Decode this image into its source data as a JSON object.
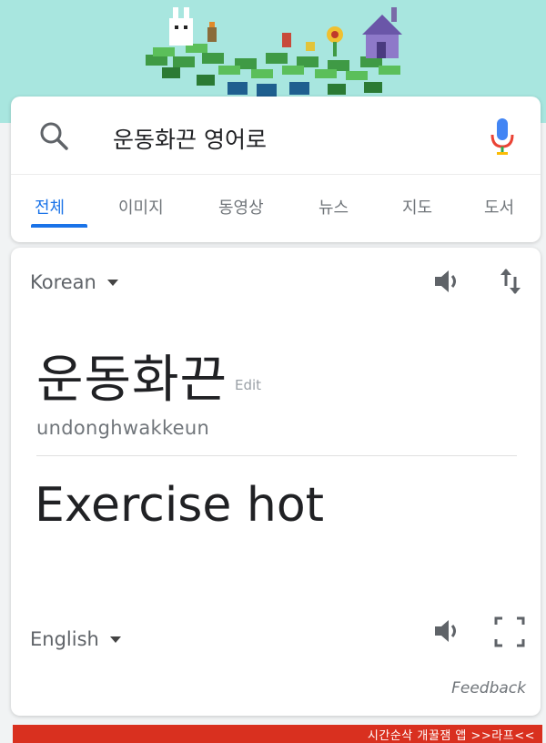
{
  "search": {
    "query": "운동화끈 영어로",
    "tabs": [
      {
        "label": "전체"
      },
      {
        "label": "이미지"
      },
      {
        "label": "동영상"
      },
      {
        "label": "뉴스"
      },
      {
        "label": "지도"
      },
      {
        "label": "도서"
      }
    ],
    "active_tab": "전체"
  },
  "translator": {
    "source_language": "Korean",
    "target_language": "English",
    "source_text": "운동화끈",
    "edit_label": "Edit",
    "romanization": "undonghwakkeun",
    "target_text": "Exercise hot",
    "feedback_label": "Feedback"
  },
  "banner": {
    "text": "시간순삭 개꿀잼 앱 >>라프<<"
  },
  "colors": {
    "accent": "#1a73e8",
    "doodle_bg": "#a8e6df",
    "banner": "#d9301f"
  },
  "icons": {
    "search": "search-icon",
    "mic": "mic-icon",
    "speaker": "speaker-icon",
    "swap": "swap-languages-icon",
    "expand": "expand-icon"
  }
}
